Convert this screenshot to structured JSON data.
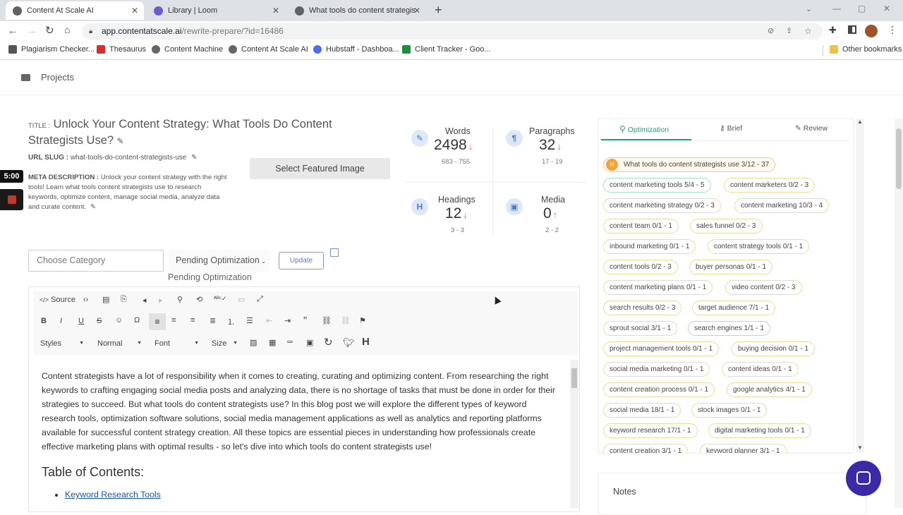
{
  "browser": {
    "tabs": [
      {
        "title": "Content At Scale AI",
        "active": true
      },
      {
        "title": "Library | Loom",
        "active": false
      },
      {
        "title": "What tools do content strategist",
        "active": false
      }
    ],
    "new_tab": "+",
    "url_domain": "app.contentatscale.ai",
    "url_path": "/rewrite-prepare/?id=16486",
    "bookmarks": [
      {
        "label": "Plagiarism Checker...",
        "color": "#555555"
      },
      {
        "label": "Thesaurus",
        "color": "#d32f2f"
      },
      {
        "label": "Content Machine",
        "color": "#666666"
      },
      {
        "label": "Content At Scale AI",
        "color": "#666666"
      },
      {
        "label": "Hubstaff - Dashboa...",
        "color": "#4a6cf7"
      },
      {
        "label": "Client Tracker - Goo...",
        "color": "#1e8e3e"
      }
    ],
    "other_bookmarks": "Other bookmarks"
  },
  "sidebar": {
    "projects": "Projects"
  },
  "timer": "5:00",
  "article": {
    "title_label": "TITLE :",
    "title": "Unlock Your Content Strategy: What Tools Do Content Strategists Use?",
    "slug_label": "URL SLUG :",
    "slug": "what-tools-do-content-strategists-use",
    "meta_label": "META DESCRIPTION :",
    "meta": "Unlock your content strategy with the right tools! Learn what tools content strategists use to research keywords, optimize content, manage social media, analyze data and curate content.",
    "featured_button": "Select Featured Image",
    "category_placeholder": "Choose Category",
    "status_select": "Pending Optimization",
    "status_text": "Pending Optimization",
    "update_button": "Update"
  },
  "stats": [
    {
      "label": "Words",
      "value": "2498",
      "arrow": "↓",
      "range": "683 - 755",
      "icon": "✎"
    },
    {
      "label": "Paragraphs",
      "value": "32",
      "arrow": "↓",
      "range": "17 - 19",
      "icon": "¶"
    },
    {
      "label": "Headings",
      "value": "12",
      "arrow": "↓",
      "range": "3 - 3",
      "icon": "H"
    },
    {
      "label": "Media",
      "value": "0",
      "arrow": "↑",
      "range": "2 - 2",
      "icon": "▣"
    }
  ],
  "editor": {
    "toolbar_source": "Source",
    "styles": "Styles",
    "format": "Normal",
    "font": "Font",
    "size": "Size",
    "body": "Content strategists have a lot of responsibility when it comes to creating, curating and optimizing content. From researching the right keywords to crafting engaging social media posts and analyzing data, there is no shortage of tasks that must be done in order for their strategies to succeed. But what tools do content strategists use? In this blog post we will explore the different types of keyword research tools, optimization software solutions, social media management applications as well as analytics and reporting platforms available for successful content strategy creation. All these topics are essential pieces in understanding how professionals create effective marketing plans with optimal results - so let's dive into which tools do content strategists use!",
    "toc_heading": "Table of Contents:",
    "toc_item": "Keyword Research Tools"
  },
  "panel": {
    "tabs": [
      "Optimization",
      "Brief",
      "Review"
    ],
    "keywords": [
      {
        "text": "What tools do content strategists use 3/12 - 37",
        "kind": "top"
      },
      {
        "text": "content marketing tools 5/4 - 5",
        "kind": "green"
      },
      {
        "text": "content marketers 0/2 - 3",
        "kind": "normal"
      },
      {
        "text": "content marketing strategy 0/2 - 3",
        "kind": "normal"
      },
      {
        "text": "content marketing 10/3 - 4",
        "kind": "normal"
      },
      {
        "text": "content team 0/1 - 1",
        "kind": "normal"
      },
      {
        "text": "sales funnel 0/2 - 3",
        "kind": "normal"
      },
      {
        "text": "inbound marketing 0/1 - 1",
        "kind": "normal"
      },
      {
        "text": "content strategy tools 0/1 - 1",
        "kind": "normal"
      },
      {
        "text": "content tools 0/2 - 3",
        "kind": "normal"
      },
      {
        "text": "buyer personas 0/1 - 1",
        "kind": "normal"
      },
      {
        "text": "content marketing plans 0/1 - 1",
        "kind": "normal"
      },
      {
        "text": "video content 0/2 - 3",
        "kind": "normal"
      },
      {
        "text": "search results 0/2 - 3",
        "kind": "normal"
      },
      {
        "text": "target audience 7/1 - 1",
        "kind": "normal"
      },
      {
        "text": "sprout social 3/1 - 1",
        "kind": "normal"
      },
      {
        "text": "search engines 1/1 - 1",
        "kind": "green"
      },
      {
        "text": "project management tools 0/1 - 1",
        "kind": "normal"
      },
      {
        "text": "buying decision 0/1 - 1",
        "kind": "normal"
      },
      {
        "text": "social media marketing 0/1 - 1",
        "kind": "normal"
      },
      {
        "text": "content ideas 0/1 - 1",
        "kind": "normal"
      },
      {
        "text": "content creation process 0/1 - 1",
        "kind": "normal"
      },
      {
        "text": "google analytics 4/1 - 1",
        "kind": "normal"
      },
      {
        "text": "social media 18/1 - 1",
        "kind": "normal"
      },
      {
        "text": "stock images 0/1 - 1",
        "kind": "normal"
      },
      {
        "text": "keyword research 17/1 - 1",
        "kind": "normal"
      },
      {
        "text": "digital marketing tools 0/1 - 1",
        "kind": "normal"
      },
      {
        "text": "content creation 3/1 - 1",
        "kind": "normal"
      },
      {
        "text": "keyword planner 3/1 - 1",
        "kind": "normal"
      }
    ],
    "notes": "Notes"
  }
}
